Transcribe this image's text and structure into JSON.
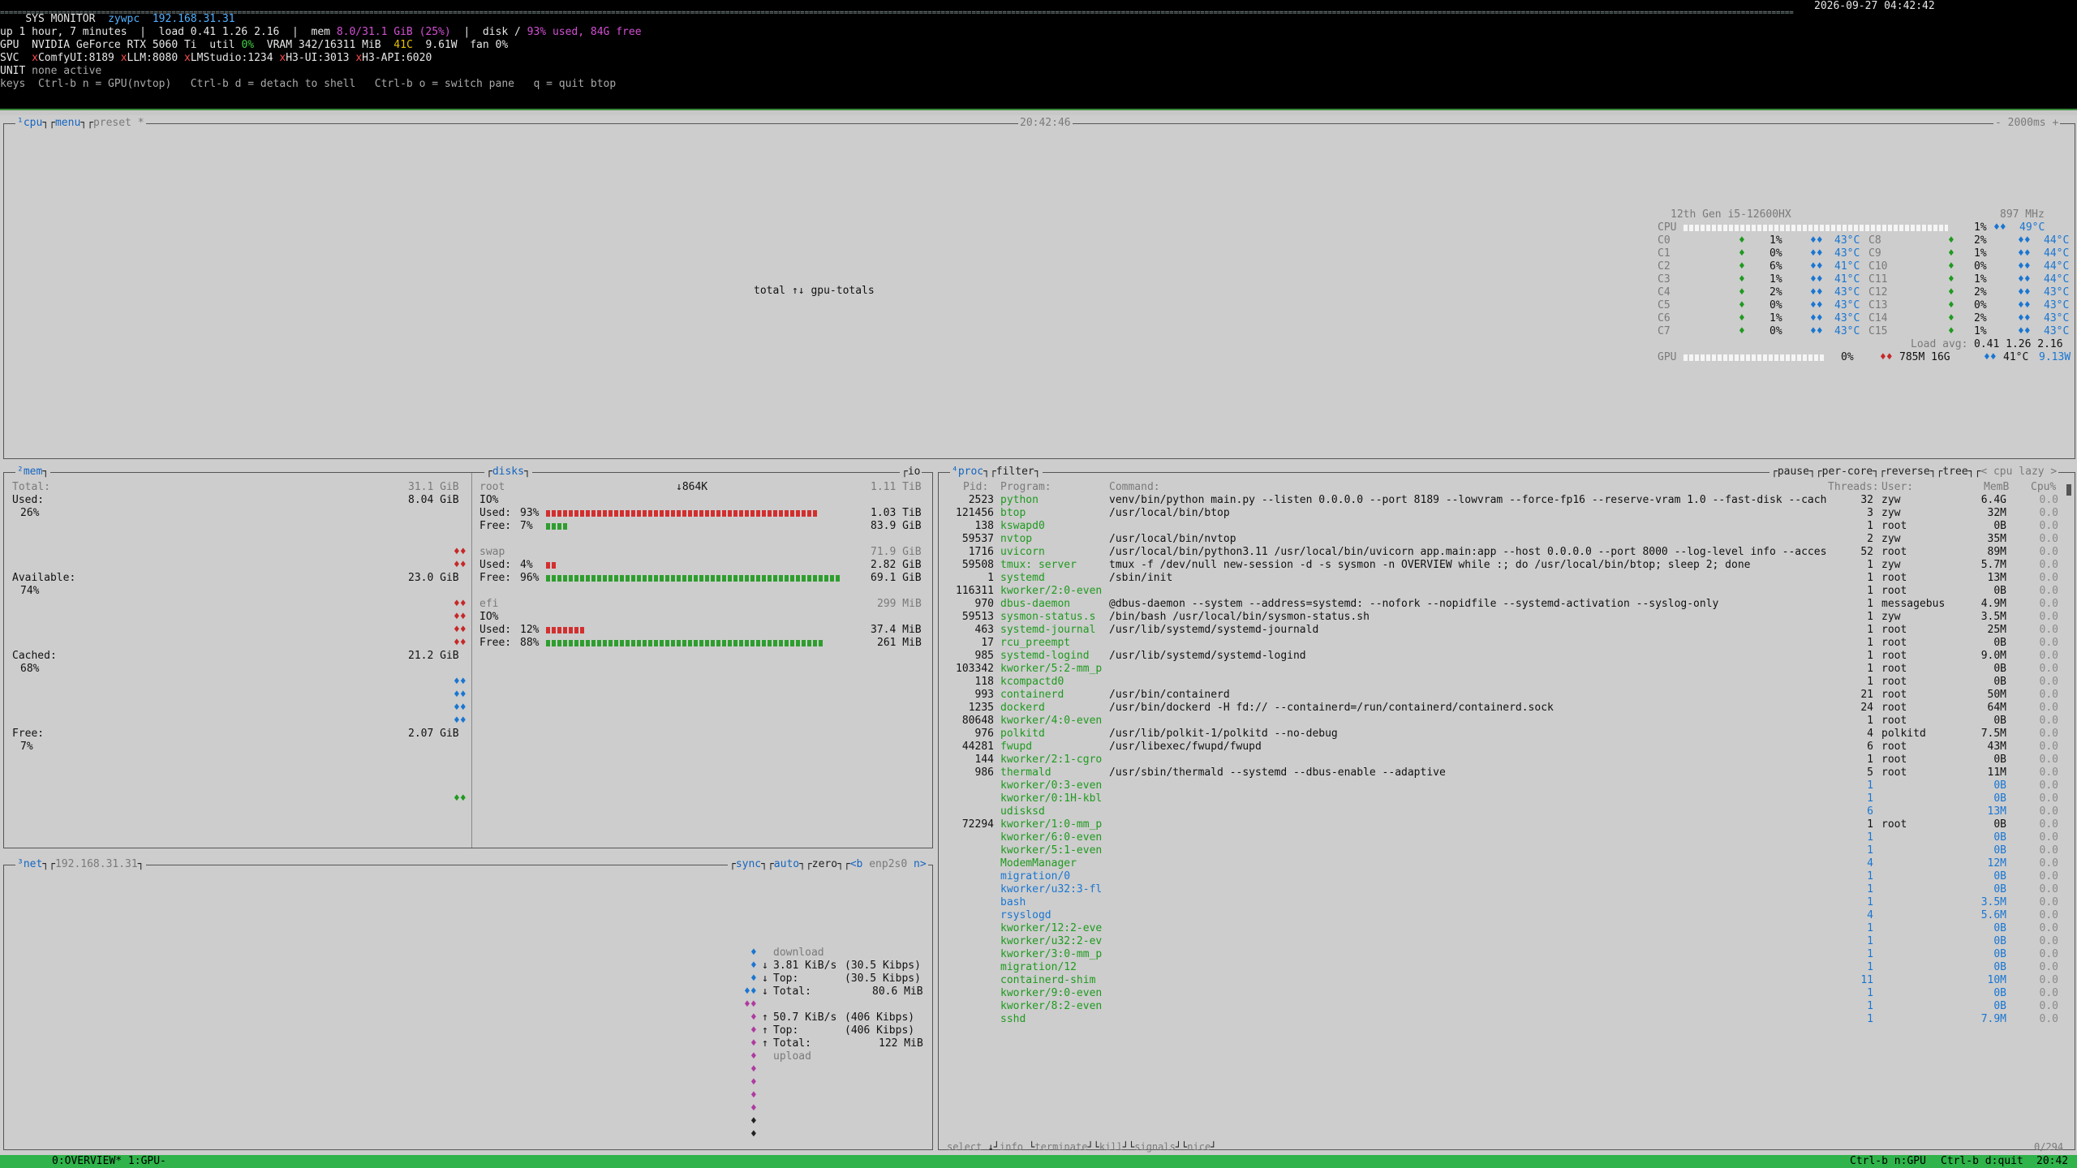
{
  "header": {
    "title": "SYS MONITOR",
    "user": "zywpc",
    "ip": "192.168.31.31",
    "datetime": "2026-09-27 04:42:42",
    "uptime_line": "up 1 hour, 7 minutes  |  load 0.41 1.26 2.16  |  mem ",
    "mem_value": "8.0/31.1 GiB (25%)",
    "disk_label": "  |  disk / ",
    "disk_value": "93% used, 84G free",
    "gpu_label": "GPU",
    "gpu_name": "NVIDIA GeForce RTX 5060 Ti",
    "gpu_util_label": "util",
    "gpu_util": "0%",
    "gpu_vram": "VRAM 342/16311 MiB",
    "gpu_temp": "41C",
    "gpu_power": "9.61W",
    "gpu_fan": "fan 0%",
    "svc_label": "SVC",
    "services": [
      "ComfyUI:8189",
      "LLM:8080",
      "LMStudio:1234",
      "H3-UI:3013",
      "H3-API:6020"
    ],
    "unit_label": "UNIT",
    "unit_value": "none active",
    "keys_label": "keys",
    "keys_value": "Ctrl-b n = GPU(nvtop)   Ctrl-b d = detach to shell   Ctrl-b o = switch pane   q = quit btop"
  },
  "cpu_pane": {
    "tabs": [
      "¹cpu",
      "menu",
      "preset *"
    ],
    "clock": "20:42:46",
    "refresh": "- 2000ms +",
    "center_label": "total ↑↓ gpu-totals",
    "cpu_model": "12th Gen i5-12600HX",
    "freq": "897 MHz",
    "cpu_total_label": "CPU",
    "cpu_total_pct": "1%",
    "cpu_total_temp": "49°C",
    "cores_left": [
      {
        "name": "C0",
        "pct": "1%",
        "temp": "43°C"
      },
      {
        "name": "C1",
        "pct": "0%",
        "temp": "43°C"
      },
      {
        "name": "C2",
        "pct": "6%",
        "temp": "41°C"
      },
      {
        "name": "C3",
        "pct": "1%",
        "temp": "41°C"
      },
      {
        "name": "C4",
        "pct": "2%",
        "temp": "43°C"
      },
      {
        "name": "C5",
        "pct": "0%",
        "temp": "43°C"
      },
      {
        "name": "C6",
        "pct": "1%",
        "temp": "43°C"
      },
      {
        "name": "C7",
        "pct": "0%",
        "temp": "43°C"
      }
    ],
    "cores_right": [
      {
        "name": "C8",
        "pct": "2%",
        "temp": "44°C"
      },
      {
        "name": "C9",
        "pct": "1%",
        "temp": "44°C"
      },
      {
        "name": "C10",
        "pct": "0%",
        "temp": "44°C"
      },
      {
        "name": "C11",
        "pct": "1%",
        "temp": "44°C"
      },
      {
        "name": "C12",
        "pct": "2%",
        "temp": "43°C"
      },
      {
        "name": "C13",
        "pct": "0%",
        "temp": "43°C"
      },
      {
        "name": "C14",
        "pct": "2%",
        "temp": "43°C"
      },
      {
        "name": "C15",
        "pct": "1%",
        "temp": "43°C"
      }
    ],
    "load_avg_label": "Load avg:",
    "load_avg": "0.41 1.26 2.16",
    "gpu_label": "GPU",
    "gpu_pct": "0%",
    "gpu_mem": "785M 16G",
    "gpu_temp": "41°C",
    "gpu_watt": "9.13W"
  },
  "mem_pane": {
    "title": "²mem",
    "total_label": "Total:",
    "total": "31.1 GiB",
    "used_label": "Used:",
    "used": "8.04 GiB",
    "used_pct": "26%",
    "available_label": "Available:",
    "available": "23.0 GiB",
    "available_pct": "74%",
    "cached_label": "Cached:",
    "cached": "21.2 GiB",
    "cached_pct": "68%",
    "free_label": "Free:",
    "free": "2.07 GiB",
    "free_pct": "7%"
  },
  "disks_pane": {
    "title": "disks",
    "io_title": "io",
    "io_rate": "↓864K",
    "root": {
      "name": "root",
      "size": "1.11 TiB",
      "io": "IO%",
      "used_label": "Used:",
      "used_pct": "93%",
      "used_val": "1.03 TiB",
      "used_fill": 0.93,
      "free_label": "Free:",
      "free_pct": "7%",
      "free_val": "83.9 GiB",
      "free_fill": 0.07
    },
    "swap": {
      "name": "swap",
      "size": "71.9 GiB",
      "used_label": "Used:",
      "used_pct": "4%",
      "used_val": "2.82 GiB",
      "used_fill": 0.04,
      "free_label": "Free:",
      "free_pct": "96%",
      "free_val": "69.1 GiB",
      "free_fill": 0.96
    },
    "efi": {
      "name": "efi",
      "size": "299 MiB",
      "io": "IO%",
      "used_label": "Used:",
      "used_pct": "12%",
      "used_val": "37.4 MiB",
      "used_fill": 0.12,
      "free_label": "Free:",
      "free_pct": "88%",
      "free_val": "261 MiB",
      "free_fill": 0.88
    }
  },
  "net_pane": {
    "title": "³net",
    "ip": "192.168.31.31",
    "opts": [
      "sync",
      "auto",
      "zero",
      "<b",
      "enp2s0",
      "n>"
    ],
    "download_label": "download",
    "dl_rate": "3.81 KiB/s",
    "dl_bits": "(30.5 Kibps)",
    "dl_top_label": "Top:",
    "dl_top": "(30.5 Kibps)",
    "dl_total_label": "Total:",
    "dl_total": "80.6 MiB",
    "ul_rate": "50.7 KiB/s",
    "ul_bits": "(406 Kibps)",
    "ul_top_label": "Top:",
    "ul_top": "(406 Kibps)",
    "ul_total_label": "Total:",
    "ul_total": "122 MiB",
    "upload_label": "upload"
  },
  "proc_pane": {
    "title": "⁴proc",
    "filter": "filter",
    "opts": [
      "pause",
      "per-core",
      "reverse",
      "tree",
      "< cpu lazy >"
    ],
    "headers": {
      "pid": "Pid:",
      "program": "Program:",
      "command": "Command:",
      "threads": "Threads:",
      "user": "User:",
      "mem": "MemB",
      "cpu": "Cpu%"
    },
    "rows": [
      {
        "pid": "2523",
        "program": "python",
        "command": "venv/bin/python main.py --listen 0.0.0.0 --port 8189 --lowvram --force-fp16 --reserve-vram 1.0 --fast-disk --cach",
        "threads": "32",
        "user": "zyw",
        "mem": "6.4G",
        "cpu": "0.0"
      },
      {
        "pid": "121456",
        "program": "btop",
        "command": "/usr/local/bin/btop",
        "threads": "3",
        "user": "zyw",
        "mem": "32M",
        "cpu": "0.0"
      },
      {
        "pid": "138",
        "program": "kswapd0",
        "command": "",
        "threads": "1",
        "user": "root",
        "mem": "0B",
        "cpu": "0.0"
      },
      {
        "pid": "59537",
        "program": "nvtop",
        "command": "/usr/local/bin/nvtop",
        "threads": "2",
        "user": "zyw",
        "mem": "35M",
        "cpu": "0.0"
      },
      {
        "pid": "1716",
        "program": "uvicorn",
        "command": "/usr/local/bin/python3.11 /usr/local/bin/uvicorn app.main:app --host 0.0.0.0 --port 8000 --log-level info --acces",
        "threads": "52",
        "user": "root",
        "mem": "89M",
        "cpu": "0.0"
      },
      {
        "pid": "59508",
        "program": "tmux: server",
        "command": "tmux -f /dev/null new-session -d -s sysmon -n OVERVIEW while :; do /usr/local/bin/btop; sleep 2; done",
        "threads": "1",
        "user": "zyw",
        "mem": "5.7M",
        "cpu": "0.0"
      },
      {
        "pid": "1",
        "program": "systemd",
        "command": "/sbin/init",
        "threads": "1",
        "user": "root",
        "mem": "13M",
        "cpu": "0.0"
      },
      {
        "pid": "116311",
        "program": "kworker/2:0-even",
        "command": "",
        "threads": "1",
        "user": "root",
        "mem": "0B",
        "cpu": "0.0"
      },
      {
        "pid": "970",
        "program": "dbus-daemon",
        "command": "@dbus-daemon --system --address=systemd: --nofork --nopidfile --systemd-activation --syslog-only",
        "threads": "1",
        "user": "messagebus",
        "mem": "4.9M",
        "cpu": "0.0"
      },
      {
        "pid": "59513",
        "program": "sysmon-status.s",
        "command": "/bin/bash /usr/local/bin/sysmon-status.sh",
        "threads": "1",
        "user": "zyw",
        "mem": "3.5M",
        "cpu": "0.0"
      },
      {
        "pid": "463",
        "program": "systemd-journal",
        "command": "/usr/lib/systemd/systemd-journald",
        "threads": "1",
        "user": "root",
        "mem": "25M",
        "cpu": "0.0"
      },
      {
        "pid": "17",
        "program": "rcu_preempt",
        "command": "",
        "threads": "1",
        "user": "root",
        "mem": "0B",
        "cpu": "0.0"
      },
      {
        "pid": "985",
        "program": "systemd-logind",
        "command": "/usr/lib/systemd/systemd-logind",
        "threads": "1",
        "user": "root",
        "mem": "9.0M",
        "cpu": "0.0"
      },
      {
        "pid": "103342",
        "program": "kworker/5:2-mm_p",
        "command": "",
        "threads": "1",
        "user": "root",
        "mem": "0B",
        "cpu": "0.0"
      },
      {
        "pid": "118",
        "program": "kcompactd0",
        "command": "",
        "threads": "1",
        "user": "root",
        "mem": "0B",
        "cpu": "0.0"
      },
      {
        "pid": "993",
        "program": "containerd",
        "command": "/usr/bin/containerd",
        "threads": "21",
        "user": "root",
        "mem": "50M",
        "cpu": "0.0"
      },
      {
        "pid": "1235",
        "program": "dockerd",
        "command": "/usr/bin/dockerd -H fd:// --containerd=/run/containerd/containerd.sock",
        "threads": "24",
        "user": "root",
        "mem": "64M",
        "cpu": "0.0"
      },
      {
        "pid": "80648",
        "program": "kworker/4:0-even",
        "command": "",
        "threads": "1",
        "user": "root",
        "mem": "0B",
        "cpu": "0.0"
      },
      {
        "pid": "976",
        "program": "polkitd",
        "command": "/usr/lib/polkit-1/polkitd --no-debug",
        "threads": "4",
        "user": "polkitd",
        "mem": "7.5M",
        "cpu": "0.0"
      },
      {
        "pid": "44281",
        "program": "fwupd",
        "command": "/usr/libexec/fwupd/fwupd",
        "threads": "6",
        "user": "root",
        "mem": "43M",
        "cpu": "0.0"
      },
      {
        "pid": "144",
        "program": "kworker/2:1-cgro",
        "command": "",
        "threads": "1",
        "user": "root",
        "mem": "0B",
        "cpu": "0.0"
      },
      {
        "pid": "986",
        "program": "thermald",
        "command": "/usr/sbin/thermald --systemd --dbus-enable --adaptive",
        "threads": "5",
        "user": "root",
        "mem": "11M",
        "cpu": "0.0"
      },
      {
        "pid": "",
        "program": "kworker/0:3-even",
        "command": "",
        "threads": "1",
        "user": "",
        "mem": "0B",
        "cpu": "0.0"
      },
      {
        "pid": "",
        "program": "kworker/0:1H-kbl",
        "command": "",
        "threads": "1",
        "user": "",
        "mem": "0B",
        "cpu": "0.0"
      },
      {
        "pid": "",
        "program": "udisksd",
        "command": "",
        "threads": "6",
        "user": "",
        "mem": "13M",
        "cpu": "0.0"
      },
      {
        "pid": "72294",
        "program": "kworker/1:0-mm_p",
        "command": "",
        "threads": "1",
        "user": "root",
        "mem": "0B",
        "cpu": "0.0"
      },
      {
        "pid": "",
        "program": "kworker/6:0-even",
        "command": "",
        "threads": "1",
        "user": "",
        "mem": "0B",
        "cpu": "0.0"
      },
      {
        "pid": "",
        "program": "kworker/5:1-even",
        "command": "",
        "threads": "1",
        "user": "",
        "mem": "0B",
        "cpu": "0.0"
      },
      {
        "pid": "",
        "program": "ModemManager",
        "command": "",
        "threads": "4",
        "user": "",
        "mem": "12M",
        "cpu": "0.0"
      },
      {
        "pid": "",
        "program": "migration/0",
        "command": "",
        "threads": "1",
        "user": "",
        "mem": "0B",
        "cpu": "0.0"
      },
      {
        "pid": "",
        "program": "kworker/u32:3-fl",
        "command": "",
        "threads": "1",
        "user": "",
        "mem": "0B",
        "cpu": "0.0"
      },
      {
        "pid": "",
        "program": "bash",
        "command": "",
        "threads": "1",
        "user": "",
        "mem": "3.5M",
        "cpu": "0.0"
      },
      {
        "pid": "",
        "program": "rsyslogd",
        "command": "",
        "threads": "4",
        "user": "",
        "mem": "5.6M",
        "cpu": "0.0"
      },
      {
        "pid": "",
        "program": "kworker/12:2-eve",
        "command": "",
        "threads": "1",
        "user": "",
        "mem": "0B",
        "cpu": "0.0"
      },
      {
        "pid": "",
        "program": "kworker/u32:2-ev",
        "command": "",
        "threads": "1",
        "user": "",
        "mem": "0B",
        "cpu": "0.0"
      },
      {
        "pid": "",
        "program": "kworker/3:0-mm_p",
        "command": "",
        "threads": "1",
        "user": "",
        "mem": "0B",
        "cpu": "0.0"
      },
      {
        "pid": "",
        "program": "migration/12",
        "command": "",
        "threads": "1",
        "user": "",
        "mem": "0B",
        "cpu": "0.0"
      },
      {
        "pid": "",
        "program": "containerd-shim",
        "command": "",
        "threads": "11",
        "user": "",
        "mem": "10M",
        "cpu": "0.0"
      },
      {
        "pid": "",
        "program": "kworker/9:0-even",
        "command": "",
        "threads": "1",
        "user": "",
        "mem": "0B",
        "cpu": "0.0"
      },
      {
        "pid": "",
        "program": "kworker/8:2-even",
        "command": "",
        "threads": "1",
        "user": "",
        "mem": "0B",
        "cpu": "0.0"
      },
      {
        "pid": "",
        "program": "sshd",
        "command": "",
        "threads": "1",
        "user": "",
        "mem": "7.9M",
        "cpu": "0.0"
      }
    ],
    "footer": [
      "select",
      "info",
      "terminate",
      "kill",
      "signals",
      "nice"
    ],
    "count": "0/294"
  },
  "statusbar": {
    "windows": "0:OVERVIEW* 1:GPU-",
    "hint1": "Ctrl-b n:GPU",
    "hint2": "Ctrl-b d:quit",
    "time": "20:42"
  },
  "colors": {
    "accent_blue": "#1976d2",
    "proc_green": "#1f9a1f",
    "status_green": "#2fb34a",
    "bar_red": "#d32f2f",
    "bar_green": "#2e9e2e"
  }
}
